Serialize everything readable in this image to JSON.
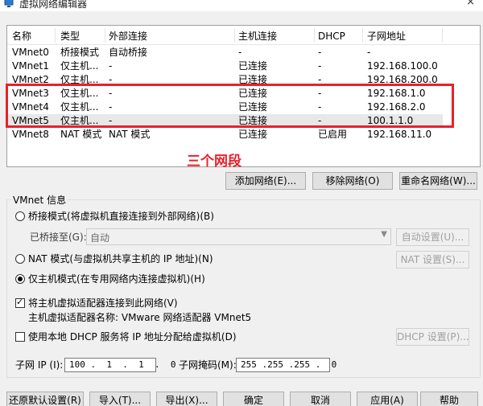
{
  "window": {
    "title": "虚拟网络编辑器",
    "close_glyph": "×"
  },
  "table": {
    "columns": [
      "名称",
      "类型",
      "外部连接",
      "主机连接",
      "DHCP",
      "子网地址"
    ],
    "rows": [
      [
        "VMnet0",
        "桥接模式",
        "自动桥接",
        "-",
        "-",
        "-"
      ],
      [
        "VMnet1",
        "仅主机...",
        "-",
        "已连接",
        "-",
        "192.168.100.0"
      ],
      [
        "VMnet2",
        "仅主机...",
        "-",
        "已连接",
        "-",
        "192.168.200.0"
      ],
      [
        "VMnet3",
        "仅主机...",
        "-",
        "已连接",
        "-",
        "192.168.1.0"
      ],
      [
        "VMnet4",
        "仅主机...",
        "-",
        "已连接",
        "-",
        "192.168.2.0"
      ],
      [
        "VMnet5",
        "仅主机...",
        "-",
        "已连接",
        "-",
        "100.1.1.0"
      ],
      [
        "VMnet8",
        "NAT 模式",
        "NAT 模式",
        "已连接",
        "已启用",
        "192.168.11.0"
      ]
    ],
    "selected_row": "VMnet5"
  },
  "annotation": {
    "text": "三个网段",
    "color": "#e8212a"
  },
  "table_buttons": {
    "add": "添加网络(E)...",
    "remove": "移除网络(O)",
    "rename": "重命名网络(W)..."
  },
  "vmnet_info": {
    "title": "VMnet 信息",
    "bridged_label": "桥接模式(将虚拟机直接连接到外部网络)(B)",
    "bridged_to_label": "已桥接至(G):",
    "bridged_to_value": "自动",
    "auto_settings": "自动设置(U)...",
    "nat_label": "NAT 模式(与虚拟机共享主机的 IP 地址)(N)",
    "nat_settings": "NAT 设置(S)...",
    "hostonly_label": "仅主机模式(在专用网络内连接虚拟机)(H)",
    "connect_adapter_label": "将主机虚拟适配器连接到此网络(V)",
    "adapter_name_label": "主机虚拟适配器名称: VMware 网络适配器 VMnet5",
    "dhcp_label": "使用本地 DHCP 服务将 IP 地址分配给虚拟机(D)",
    "dhcp_settings": "DHCP 设置(P)...",
    "subnet_ip_label": "子网 IP (I):",
    "subnet_ip_value": "100 .  1  .  1  .  0",
    "subnet_mask_label": "子网掩码(M):",
    "subnet_mask_value": "255 .255 .255 .  0"
  },
  "footer_buttons": {
    "restore": "还原默认设置(R)",
    "import": "导入(T)...",
    "export": "导出(X)...",
    "ok": "确定",
    "cancel": "取消",
    "apply": "应用(A)",
    "help": "帮助"
  }
}
